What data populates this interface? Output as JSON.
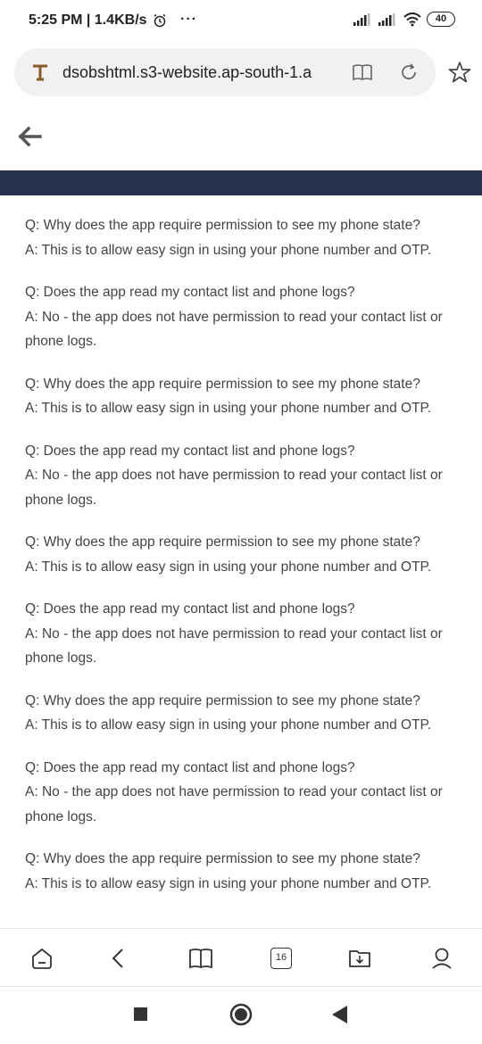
{
  "status_bar": {
    "time": "5:25 PM | 1.4KB/s",
    "more": "···",
    "battery": "40"
  },
  "browser": {
    "url": "dsobshtml.s3-website.ap-south-1.a",
    "tab_count": "16"
  },
  "faq": [
    {
      "q": "Q: Why does the app require permission to see my phone state?",
      "a": "A: This is to allow easy sign in using your phone number and OTP."
    },
    {
      "q": "Q: Does the app read my contact list and phone logs?",
      "a": "A: No - the app does not have permission to read your contact list or phone logs."
    },
    {
      "q": "Q: Why does the app require permission to see my phone state?",
      "a": "A: This is to allow easy sign in using your phone number and OTP."
    },
    {
      "q": "Q: Does the app read my contact list and phone logs?",
      "a": "A: No - the app does not have permission to read your contact list or phone logs."
    },
    {
      "q": "Q: Why does the app require permission to see my phone state?",
      "a": "A: This is to allow easy sign in using your phone number and OTP."
    },
    {
      "q": "Q: Does the app read my contact list and phone logs?",
      "a": "A: No - the app does not have permission to read your contact list or phone logs."
    },
    {
      "q": "Q: Why does the app require permission to see my phone state?",
      "a": "A: This is to allow easy sign in using your phone number and OTP."
    },
    {
      "q": "Q: Does the app read my contact list and phone logs?",
      "a": "A: No - the app does not have permission to read your contact list or phone logs."
    },
    {
      "q": "Q: Why does the app require permission to see my phone state?",
      "a": "A: This is to allow easy sign in using your phone number and OTP."
    }
  ],
  "colors": {
    "header_band": "#27304e",
    "address_bg": "#f1f1f1",
    "text": "#444444"
  },
  "icons": {
    "status": [
      "alarm-icon",
      "signal-icon",
      "wifi-icon",
      "battery-icon"
    ],
    "browser": [
      "site-favicon-icon",
      "reader-mode-icon",
      "refresh-icon",
      "star-icon",
      "back-arrow-icon"
    ],
    "bottom_nav": [
      "home-icon",
      "back-icon",
      "bookmarks-icon",
      "tabs-icon",
      "downloads-icon",
      "profile-icon"
    ],
    "system_nav": [
      "recents-icon",
      "home-circle-icon",
      "back-triangle-icon"
    ]
  }
}
